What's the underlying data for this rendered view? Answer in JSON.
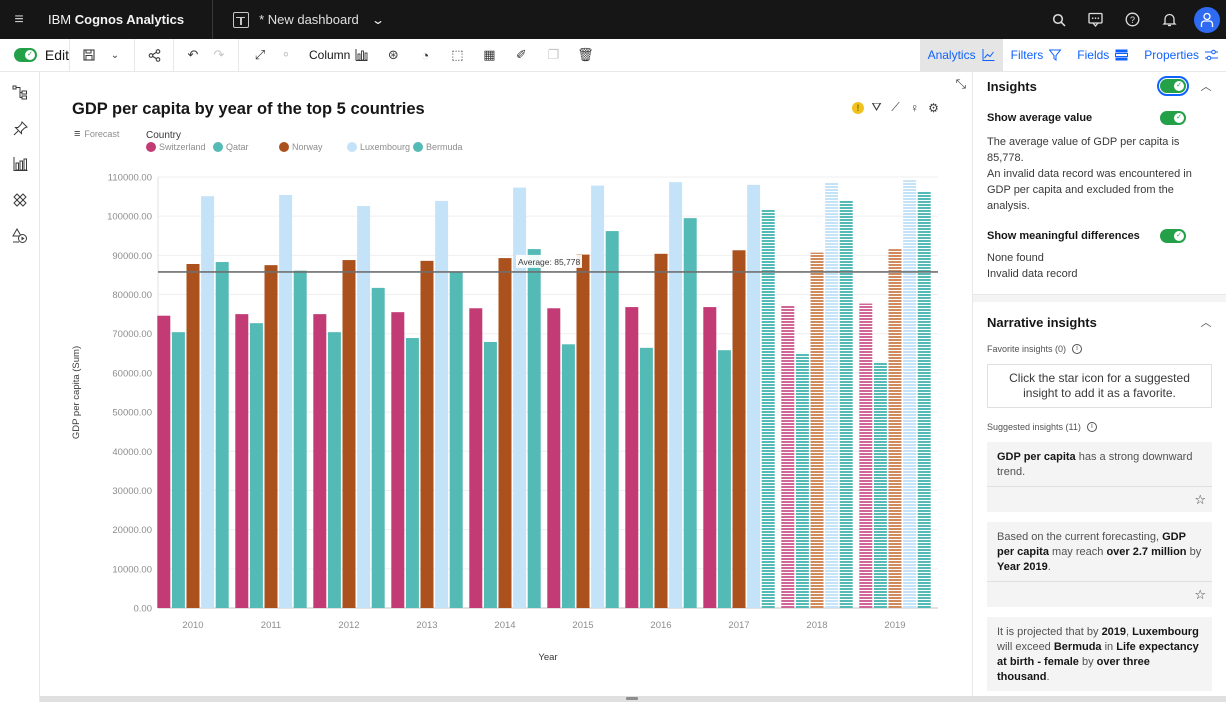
{
  "topbar": {
    "menu_icon": "hamburger-icon",
    "brand_prefix": "IBM ",
    "brand_name": "Cognos Analytics",
    "dashboard_title": "* New dashboard",
    "icons": [
      "search-icon",
      "chat-icon",
      "help-icon",
      "notification-icon",
      "user-avatar-icon"
    ]
  },
  "toolbar": {
    "edit_label": "Edit",
    "edit_on": true,
    "chart_type_label": "Column",
    "tabs": [
      {
        "label": "Analytics",
        "icon": "analytics-icon",
        "active": true
      },
      {
        "label": "Filters",
        "icon": "filter-icon",
        "active": false
      },
      {
        "label": "Fields",
        "icon": "fields-icon",
        "active": false
      },
      {
        "label": "Properties",
        "icon": "properties-icon",
        "active": false
      }
    ]
  },
  "leftrail": {
    "icons": [
      "data-sources-icon",
      "pin-icon",
      "visualizations-icon",
      "widgets-icon",
      "shapes-media-icon"
    ]
  },
  "visualization": {
    "forecast_label": "Forecast",
    "legend_title": "Country",
    "average_label": "Average: 85,778"
  },
  "chart_data": {
    "type": "bar",
    "title": "GDP per capita by year of the top 5 countries",
    "xlabel": "Year",
    "ylabel": "GDP per capita (Sum)",
    "ylim": [
      0,
      110000
    ],
    "yticks": [
      "0.00",
      "10000.00",
      "20000.00",
      "30000.00",
      "40000.00",
      "50000.00",
      "60000.00",
      "70000.00",
      "80000.00",
      "90000.00",
      "100000.00",
      "110000.00"
    ],
    "grid": true,
    "legend_position": "top-left",
    "categories": [
      "2010",
      "2011",
      "2012",
      "2013",
      "2014",
      "2015",
      "2016",
      "2017",
      "2018",
      "2019"
    ],
    "series": [
      {
        "name": "Switzerland",
        "color": "#c23b75",
        "values": [
          74600,
          75000,
          75000,
          75500,
          76500,
          76500,
          76800,
          76800,
          77100,
          77700
        ],
        "forecast_from": 8
      },
      {
        "name": "Qatar",
        "color": "#54bab6",
        "values": [
          70400,
          72700,
          70400,
          68900,
          67900,
          67300,
          66400,
          65800,
          65100,
          62800
        ],
        "forecast_from": 8
      },
      {
        "name": "Norway",
        "color": "#ab511e",
        "values": [
          87800,
          87500,
          88800,
          88600,
          89300,
          90200,
          90400,
          91300,
          90700,
          91600
        ],
        "forecast_from": 8
      },
      {
        "name": "Luxembourg",
        "color": "#c4e3f9",
        "values": [
          105100,
          105400,
          102600,
          103900,
          107300,
          107800,
          108700,
          108000,
          108700,
          109200
        ],
        "forecast_from": 8
      },
      {
        "name": "Bermuda",
        "color": "#54bab6",
        "values": [
          88300,
          86100,
          81700,
          85800,
          91600,
          96200,
          99500,
          101800,
          104100,
          106400
        ],
        "forecast_from": 7
      }
    ],
    "reference_line": {
      "label": "Average: 85,778",
      "value": 85778
    }
  },
  "insights_panel": {
    "insights_title": "Insights",
    "insights_on": true,
    "show_average_label": "Show average value",
    "show_average_on": true,
    "average_text_1": "The average value of GDP per capita is 85,778.",
    "average_text_2": "An invalid data record was encountered in GDP per capita and excluded from the analysis.",
    "meaningful_label": "Show meaningful differences",
    "meaningful_on": true,
    "meaningful_text_1": "None found",
    "meaningful_text_2": "Invalid data record",
    "narrative_title": "Narrative insights",
    "favorite_label": "Favorite insights (0)",
    "favorite_hint": "Click the star icon for a suggested insight to add it as a favorite.",
    "suggested_label": "Suggested insights (11)",
    "cards": [
      {
        "html": "<b>GDP per capita</b> has a strong downward trend."
      },
      {
        "html": "Based on the current forecasting, <b>GDP per capita</b> may reach <b>over 2.7 million</b> by <b>Year 2019</b>."
      },
      {
        "html": "It is projected that by <b>2019</b>, <b>Luxembourg</b> will exceed <b>Bermuda</b> in <b>Life expectancy at birth - female</b> by <b>over three thousand</b>."
      }
    ]
  }
}
